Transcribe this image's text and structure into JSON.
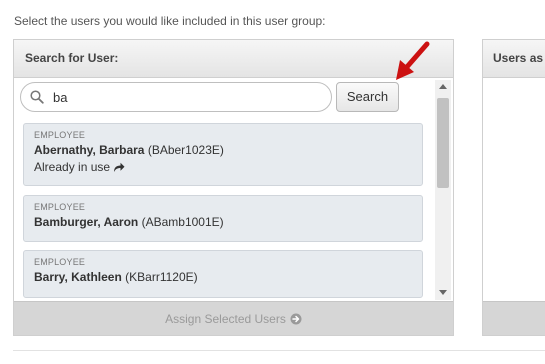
{
  "instruction": "Select the users you would like included in this user group:",
  "search_panel": {
    "title": "Search for User:",
    "search": {
      "value": "ba",
      "placeholder": ""
    },
    "search_button_label": "Search",
    "results": [
      {
        "type": "EMPLOYEE",
        "name": "Abernathy, Barbara",
        "id": "(BAber1023E)",
        "status": "Already in use"
      },
      {
        "type": "EMPLOYEE",
        "name": "Bamburger, Aaron",
        "id": "(ABamb1001E)"
      },
      {
        "type": "EMPLOYEE",
        "name": "Barry, Kathleen",
        "id": "(KBarr1120E)"
      }
    ],
    "assign_label": "Assign Selected Users"
  },
  "assigned_panel": {
    "title": "Users as"
  },
  "icons": {
    "search": "search-icon",
    "share": "share-arrow-icon",
    "assign": "arrow-circle-right-icon",
    "annotation": "red-annotation-arrow-icon"
  },
  "colors": {
    "annotation_arrow": "#cc1111",
    "card_background": "#e7ebef",
    "assign_bar": "#d6d6d6"
  }
}
